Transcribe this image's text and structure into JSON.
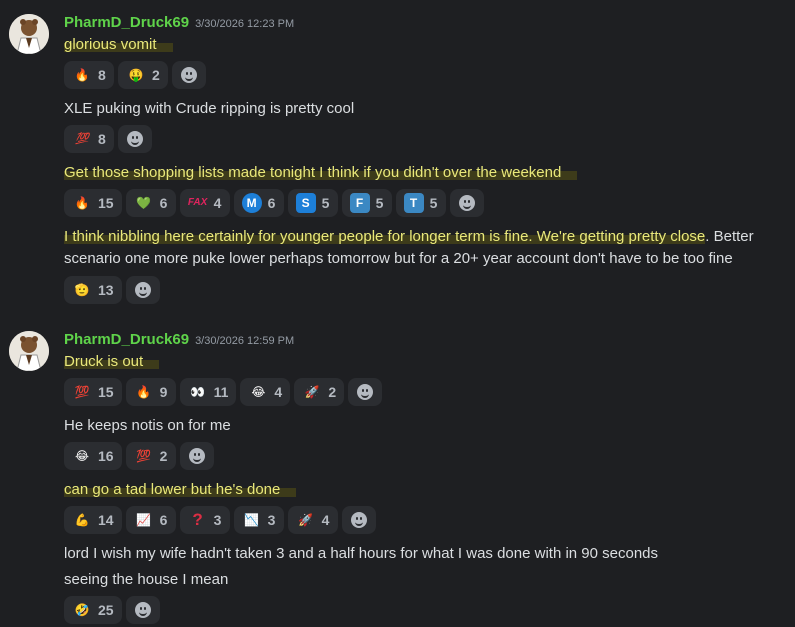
{
  "messages": [
    {
      "username": "PharmD_Druck69",
      "timestamp": "3/30/2026 12:23 PM",
      "blocks": [
        {
          "text": "glorious vomit",
          "highlight": true,
          "reactions": [
            {
              "emoji": "fire",
              "count": "8"
            },
            {
              "emoji": "money-mouth",
              "count": "2"
            }
          ]
        },
        {
          "text": "XLE puking with Crude ripping is pretty cool",
          "highlight": false,
          "reactions": [
            {
              "emoji": "hundred",
              "count": "8"
            }
          ]
        },
        {
          "text": "Get those shopping lists made tonight I think if you didn't over the weekend",
          "highlight": true,
          "reactions": [
            {
              "emoji": "fire",
              "count": "15"
            },
            {
              "emoji": "green-heart",
              "count": "6"
            },
            {
              "emoji": "fax",
              "count": "4"
            },
            {
              "emoji": "letter-m",
              "count": "6"
            },
            {
              "emoji": "letter-s",
              "count": "5"
            },
            {
              "emoji": "letter-f",
              "count": "5"
            },
            {
              "emoji": "letter-t",
              "count": "5"
            }
          ]
        },
        {
          "text_line1_hl": "I think nibbling here certainly for younger people for longer term is fine. We're getting pretty close",
          "text_line1_rest": ". Better",
          "text_line2": "scenario one more puke lower perhaps tomorrow but for a 20+ year account don't have to be too fine",
          "reactions": [
            {
              "emoji": "saluting-face",
              "count": "13"
            }
          ]
        }
      ]
    },
    {
      "username": "PharmD_Druck69",
      "timestamp": "3/30/2026 12:59 PM",
      "blocks": [
        {
          "text": "Druck is out",
          "highlight": true,
          "reactions": [
            {
              "emoji": "hundred",
              "count": "15"
            },
            {
              "emoji": "fire",
              "count": "9"
            },
            {
              "emoji": "eyes",
              "count": "11"
            },
            {
              "emoji": "joy",
              "count": "4"
            },
            {
              "emoji": "rocket",
              "count": "2"
            }
          ]
        },
        {
          "text": "He keeps notis on for me",
          "highlight": false,
          "reactions": [
            {
              "emoji": "joy",
              "count": "16"
            },
            {
              "emoji": "hundred",
              "count": "2"
            }
          ]
        },
        {
          "text": "can go a tad lower but he's done",
          "highlight": true,
          "reactions": [
            {
              "emoji": "flexed-biceps",
              "count": "14"
            },
            {
              "emoji": "chart-up",
              "count": "6"
            },
            {
              "emoji": "question-mark",
              "count": "3"
            },
            {
              "emoji": "chart-down",
              "count": "3"
            },
            {
              "emoji": "rocket",
              "count": "4"
            }
          ]
        },
        {
          "text": "lord I wish my wife hadn't taken 3 and a half hours for what I was done with in 90 seconds",
          "highlight": false
        },
        {
          "text": "seeing the house I mean",
          "highlight": false,
          "reactions": [
            {
              "emoji": "rofl",
              "count": "25"
            }
          ]
        }
      ]
    }
  ],
  "colors": {
    "background": "#1e1f22",
    "username": "#5fd34a",
    "highlight_text": "#e9e87a",
    "reaction_bg": "#2b2d31"
  }
}
